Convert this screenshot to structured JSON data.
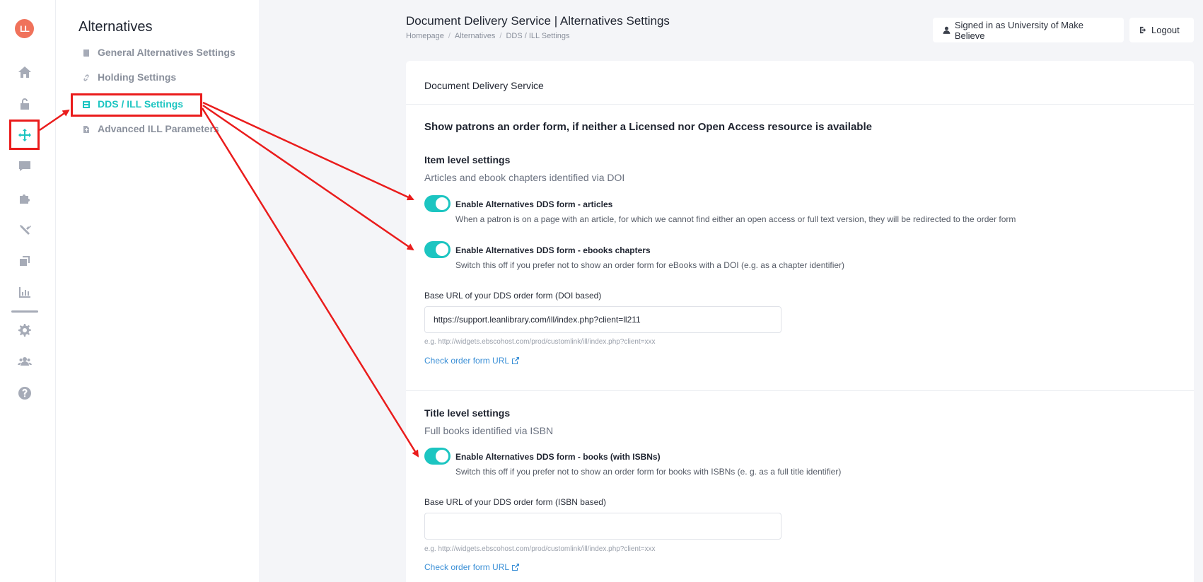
{
  "rail": {
    "logo": "LL",
    "icons": [
      "home-icon",
      "unlock-icon",
      "move-arrows-icon",
      "comment-icon",
      "puzzle-icon",
      "tools-icon",
      "copy-icon",
      "chart-bar-icon",
      "gear-icon",
      "users-icon",
      "help-icon"
    ],
    "active_icon": "move-arrows-icon",
    "highlight_color": "#ea1c1c"
  },
  "subnav": {
    "title": "Alternatives",
    "items": [
      {
        "label": "General Alternatives Settings",
        "icon": "book-icon"
      },
      {
        "label": "Holding Settings",
        "icon": "link-icon"
      },
      {
        "label": "DDS / ILL Settings",
        "icon": "settings-panel-icon",
        "active": true
      },
      {
        "label": "Advanced ILL Parameters",
        "icon": "file-icon"
      }
    ]
  },
  "header": {
    "title": "Document Delivery Service | Alternatives Settings",
    "breadcrumb": [
      "Homepage",
      "Alternatives",
      "DDS / ILL Settings"
    ],
    "signed_in": "Signed in as University of Make Believe",
    "logout": "Logout"
  },
  "card": {
    "header": "Document Delivery Service",
    "heading": "Show patrons an order form, if neither a Licensed nor Open Access resource is available",
    "item_level": {
      "title": "Item level settings",
      "subtitle": "Articles and ebook chapters identified via DOI",
      "toggles": [
        {
          "label": "Enable Alternatives DDS form - articles",
          "description": "When a patron is on a page with an article, for which we cannot find either an open access or full text version, they will be redirected to the order form",
          "on": true
        },
        {
          "label": "Enable Alternatives DDS form - ebooks chapters",
          "description": "Switch this off if you prefer not to show an order form for eBooks with a DOI (e.g. as a chapter identifier)",
          "on": true
        }
      ],
      "field_label": "Base URL of your DDS order form (DOI based)",
      "field_value": "https://support.leanlibrary.com/ill/index.php?client=ll211",
      "hint": "e.g. http://widgets.ebscohost.com/prod/customlink/ill/index.php?client=xxx",
      "check_link": "Check order form URL"
    },
    "title_level": {
      "title": "Title level settings",
      "subtitle": "Full books identified via ISBN",
      "toggles": [
        {
          "label": "Enable Alternatives DDS form - books (with ISBNs)",
          "description": "Switch this off if you prefer not to show an order form for books with ISBNs (e. g. as a full title identifier)",
          "on": true
        }
      ],
      "field_label": "Base URL of your DDS order form (ISBN based)",
      "field_value": "",
      "hint": "e.g. http://widgets.ebscohost.com/prod/customlink/ill/index.php?client=xxx",
      "check_link": "Check order form URL"
    }
  },
  "colors": {
    "accent": "#1cc5c1",
    "annotation": "#ea1c1c",
    "link": "#3a8fd6"
  }
}
